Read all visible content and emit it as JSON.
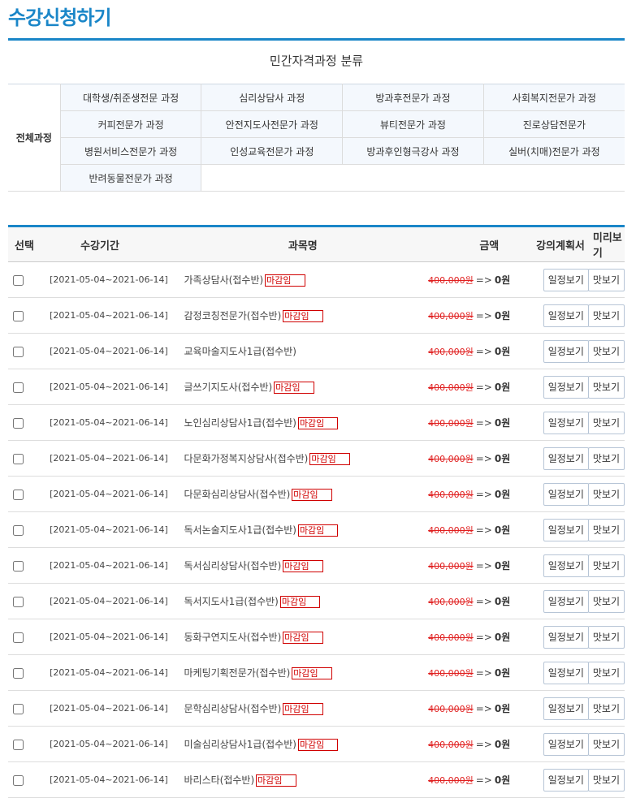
{
  "page": {
    "title": "수강신청하기"
  },
  "categories": {
    "heading": "민간자격과정 분류",
    "all_label": "전체과정",
    "items": [
      "대학생/취준생전문 과정",
      "심리상담사 과정",
      "방과후전문가 과정",
      "사회복지전문가 과정",
      "커피전문가 과정",
      "안전지도사전문가 과정",
      "뷰티전문가 과정",
      "진로상담전문가",
      "병원서비스전문가 과정",
      "인성교육전문가 과정",
      "방과후인형극강사 과정",
      "실버(치매)전문가 과정",
      "반려동물전문가 과정"
    ]
  },
  "course_table": {
    "headers": {
      "select": "선택",
      "period": "수강기간",
      "name": "과목명",
      "price": "금액",
      "plan": "강의계획서",
      "preview": "미리보기"
    },
    "plan_button": "일정보기",
    "preview_button": "맛보기",
    "closed_badge": "마감임",
    "arrow": "=>",
    "rows": [
      {
        "period": "[2021-05-04~2021-06-14]",
        "name": "가족상담사(접수반)",
        "closed": true,
        "orig_price": "400,000원",
        "final_price": "0원"
      },
      {
        "period": "[2021-05-04~2021-06-14]",
        "name": "감정코칭전문가(접수반)",
        "closed": true,
        "orig_price": "400,000원",
        "final_price": "0원"
      },
      {
        "period": "[2021-05-04~2021-06-14]",
        "name": "교육마술지도사1급(접수반)",
        "closed": false,
        "orig_price": "400,000원",
        "final_price": "0원"
      },
      {
        "period": "[2021-05-04~2021-06-14]",
        "name": "글쓰기지도사(접수반)",
        "closed": true,
        "orig_price": "400,000원",
        "final_price": "0원"
      },
      {
        "period": "[2021-05-04~2021-06-14]",
        "name": "노인심리상담사1급(접수반)",
        "closed": true,
        "orig_price": "400,000원",
        "final_price": "0원"
      },
      {
        "period": "[2021-05-04~2021-06-14]",
        "name": "다문화가정복지상담사(접수반)",
        "closed": true,
        "orig_price": "400,000원",
        "final_price": "0원"
      },
      {
        "period": "[2021-05-04~2021-06-14]",
        "name": "다문화심리상담사(접수반)",
        "closed": true,
        "orig_price": "400,000원",
        "final_price": "0원"
      },
      {
        "period": "[2021-05-04~2021-06-14]",
        "name": "독서논술지도사1급(접수반)",
        "closed": true,
        "orig_price": "400,000원",
        "final_price": "0원"
      },
      {
        "period": "[2021-05-04~2021-06-14]",
        "name": "독서심리상담사(접수반)",
        "closed": true,
        "orig_price": "400,000원",
        "final_price": "0원"
      },
      {
        "period": "[2021-05-04~2021-06-14]",
        "name": "독서지도사1급(접수반)",
        "closed": true,
        "orig_price": "400,000원",
        "final_price": "0원"
      },
      {
        "period": "[2021-05-04~2021-06-14]",
        "name": "동화구연지도사(접수반)",
        "closed": true,
        "orig_price": "400,000원",
        "final_price": "0원"
      },
      {
        "period": "[2021-05-04~2021-06-14]",
        "name": "마케팅기획전문가(접수반)",
        "closed": true,
        "orig_price": "400,000원",
        "final_price": "0원"
      },
      {
        "period": "[2021-05-04~2021-06-14]",
        "name": "문학심리상담사(접수반)",
        "closed": true,
        "orig_price": "400,000원",
        "final_price": "0원"
      },
      {
        "period": "[2021-05-04~2021-06-14]",
        "name": "미술심리상담사1급(접수반)",
        "closed": true,
        "orig_price": "400,000원",
        "final_price": "0원"
      },
      {
        "period": "[2021-05-04~2021-06-14]",
        "name": "바리스타(접수반)",
        "closed": true,
        "orig_price": "400,000원",
        "final_price": "0원"
      }
    ]
  }
}
